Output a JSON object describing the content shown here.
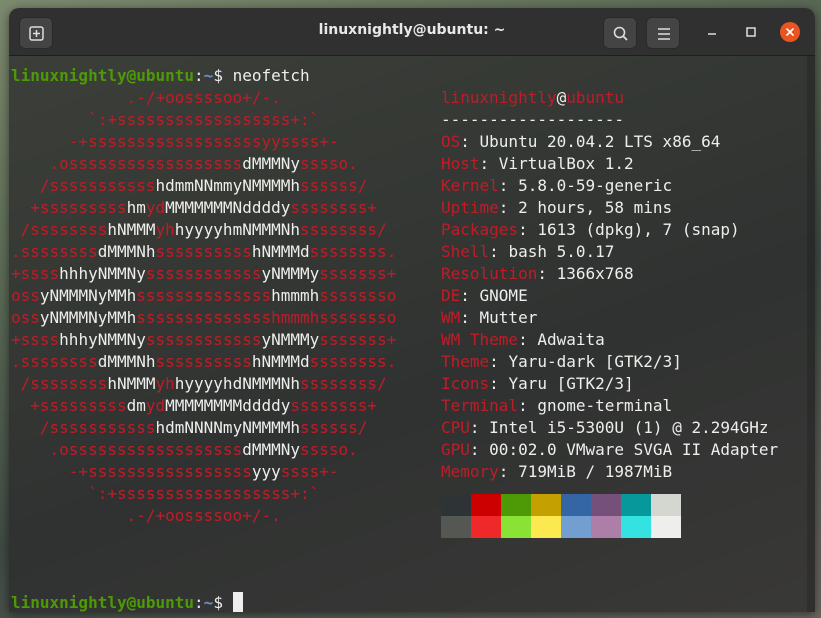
{
  "window": {
    "title": "linuxnightly@ubuntu: ~"
  },
  "prompt": {
    "user": "linuxnightly@ubuntu",
    "sep": ":",
    "path": "~",
    "symbol": "$",
    "command": "neofetch"
  },
  "colors": {
    "logo_red": "#c01c28",
    "logo_white": "#eeeeec",
    "user_green": "#4e9a06",
    "path_blue": "#6d8fc9",
    "close_orange": "#e95420"
  },
  "logo_lines": [
    [
      {
        "c": "r",
        "t": "            .-/+oossssoo+/-."
      }
    ],
    [
      {
        "c": "r",
        "t": "        `:+ssssssssssssssssss+:`"
      }
    ],
    [
      {
        "c": "r",
        "t": "      -+ssssssssssssssssssyyssss+-"
      }
    ],
    [
      {
        "c": "r",
        "t": "    .ossssssssssssssssss"
      },
      {
        "c": "w",
        "t": "dMMMNy"
      },
      {
        "c": "r",
        "t": "sssso."
      }
    ],
    [
      {
        "c": "r",
        "t": "   /sssssssssss"
      },
      {
        "c": "w",
        "t": "hdmmNNmmyNMMMMh"
      },
      {
        "c": "r",
        "t": "ssssss/"
      }
    ],
    [
      {
        "c": "r",
        "t": "  +sssssssss"
      },
      {
        "c": "w",
        "t": "hm"
      },
      {
        "c": "r",
        "t": "yd"
      },
      {
        "c": "w",
        "t": "MMMMMMMNddddy"
      },
      {
        "c": "r",
        "t": "ssssssss+"
      }
    ],
    [
      {
        "c": "r",
        "t": " /ssssssss"
      },
      {
        "c": "w",
        "t": "hNMMM"
      },
      {
        "c": "r",
        "t": "yh"
      },
      {
        "c": "w",
        "t": "hyyyyhmNMMMNh"
      },
      {
        "c": "r",
        "t": "ssssssss/"
      }
    ],
    [
      {
        "c": "r",
        "t": ".ssssssss"
      },
      {
        "c": "w",
        "t": "dMMMNh"
      },
      {
        "c": "r",
        "t": "ssssssssss"
      },
      {
        "c": "w",
        "t": "hNMMMd"
      },
      {
        "c": "r",
        "t": "ssssssss."
      }
    ],
    [
      {
        "c": "r",
        "t": "+ssss"
      },
      {
        "c": "w",
        "t": "hhhyNMMNy"
      },
      {
        "c": "r",
        "t": "ssssssssssss"
      },
      {
        "c": "w",
        "t": "yNMMMy"
      },
      {
        "c": "r",
        "t": "sssssss+"
      }
    ],
    [
      {
        "c": "r",
        "t": "oss"
      },
      {
        "c": "w",
        "t": "yNMMMNyMMh"
      },
      {
        "c": "r",
        "t": "ssssssssssssss"
      },
      {
        "c": "w",
        "t": "hmmmh"
      },
      {
        "c": "r",
        "t": "ssssssso"
      }
    ],
    [
      {
        "c": "r",
        "t": "oss"
      },
      {
        "c": "w",
        "t": "yNMMMNyMMh"
      },
      {
        "c": "r",
        "t": "sssssssssssssshmmmh"
      },
      {
        "c": "r",
        "t": "ssssssso"
      }
    ],
    [
      {
        "c": "r",
        "t": "+ssss"
      },
      {
        "c": "w",
        "t": "hhhyNMMNy"
      },
      {
        "c": "r",
        "t": "ssssssssssss"
      },
      {
        "c": "w",
        "t": "yNMMMy"
      },
      {
        "c": "r",
        "t": "sssssss+"
      }
    ],
    [
      {
        "c": "r",
        "t": ".ssssssss"
      },
      {
        "c": "w",
        "t": "dMMMNh"
      },
      {
        "c": "r",
        "t": "ssssssssss"
      },
      {
        "c": "w",
        "t": "hNMMMd"
      },
      {
        "c": "r",
        "t": "ssssssss."
      }
    ],
    [
      {
        "c": "r",
        "t": " /ssssssss"
      },
      {
        "c": "w",
        "t": "hNMMM"
      },
      {
        "c": "r",
        "t": "yh"
      },
      {
        "c": "w",
        "t": "hyyyyhdNMMMNh"
      },
      {
        "c": "r",
        "t": "ssssssss/"
      }
    ],
    [
      {
        "c": "r",
        "t": "  +sssssssss"
      },
      {
        "c": "w",
        "t": "dm"
      },
      {
        "c": "r",
        "t": "yd"
      },
      {
        "c": "w",
        "t": "MMMMMMMMddddy"
      },
      {
        "c": "r",
        "t": "ssssssss+"
      }
    ],
    [
      {
        "c": "r",
        "t": "   /sssssssssss"
      },
      {
        "c": "w",
        "t": "hdmNNNNmyNMMMMh"
      },
      {
        "c": "r",
        "t": "ssssss/"
      }
    ],
    [
      {
        "c": "r",
        "t": "    .ossssssssssssssssss"
      },
      {
        "c": "w",
        "t": "dMMMNy"
      },
      {
        "c": "r",
        "t": "sssso."
      }
    ],
    [
      {
        "c": "r",
        "t": "      -+sssssssssssssssss"
      },
      {
        "c": "w",
        "t": "yyy"
      },
      {
        "c": "r",
        "t": "ssss+-"
      }
    ],
    [
      {
        "c": "r",
        "t": "        `:+ssssssssssssssssss+:`"
      }
    ],
    [
      {
        "c": "r",
        "t": "            .-/+oossssoo+/-."
      }
    ]
  ],
  "info": {
    "user": "linuxnightly",
    "at": "@",
    "host": "ubuntu",
    "divider": "-------------------",
    "rows": [
      {
        "key": "OS",
        "value": "Ubuntu 20.04.2 LTS x86_64"
      },
      {
        "key": "Host",
        "value": "VirtualBox 1.2"
      },
      {
        "key": "Kernel",
        "value": "5.8.0-59-generic"
      },
      {
        "key": "Uptime",
        "value": "2 hours, 58 mins"
      },
      {
        "key": "Packages",
        "value": "1613 (dpkg), 7 (snap)"
      },
      {
        "key": "Shell",
        "value": "bash 5.0.17"
      },
      {
        "key": "Resolution",
        "value": "1366x768"
      },
      {
        "key": "DE",
        "value": "GNOME"
      },
      {
        "key": "WM",
        "value": "Mutter"
      },
      {
        "key": "WM Theme",
        "value": "Adwaita"
      },
      {
        "key": "Theme",
        "value": "Yaru-dark [GTK2/3]"
      },
      {
        "key": "Icons",
        "value": "Yaru [GTK2/3]"
      },
      {
        "key": "Terminal",
        "value": "gnome-terminal"
      },
      {
        "key": "CPU",
        "value": "Intel i5-5300U (1) @ 2.294GHz"
      },
      {
        "key": "GPU",
        "value": "00:02.0 VMware SVGA II Adapter"
      },
      {
        "key": "Memory",
        "value": "719MiB / 1987MiB"
      }
    ],
    "separator": ": ",
    "palette_row1": [
      "#2e3436",
      "#cc0000",
      "#4e9a06",
      "#c4a000",
      "#3465a4",
      "#75507b",
      "#06989a",
      "#d3d7cf"
    ],
    "palette_row2": [
      "#555753",
      "#ef2929",
      "#8ae234",
      "#fce94f",
      "#729fcf",
      "#ad7fa8",
      "#34e2e2",
      "#eeeeec"
    ]
  }
}
